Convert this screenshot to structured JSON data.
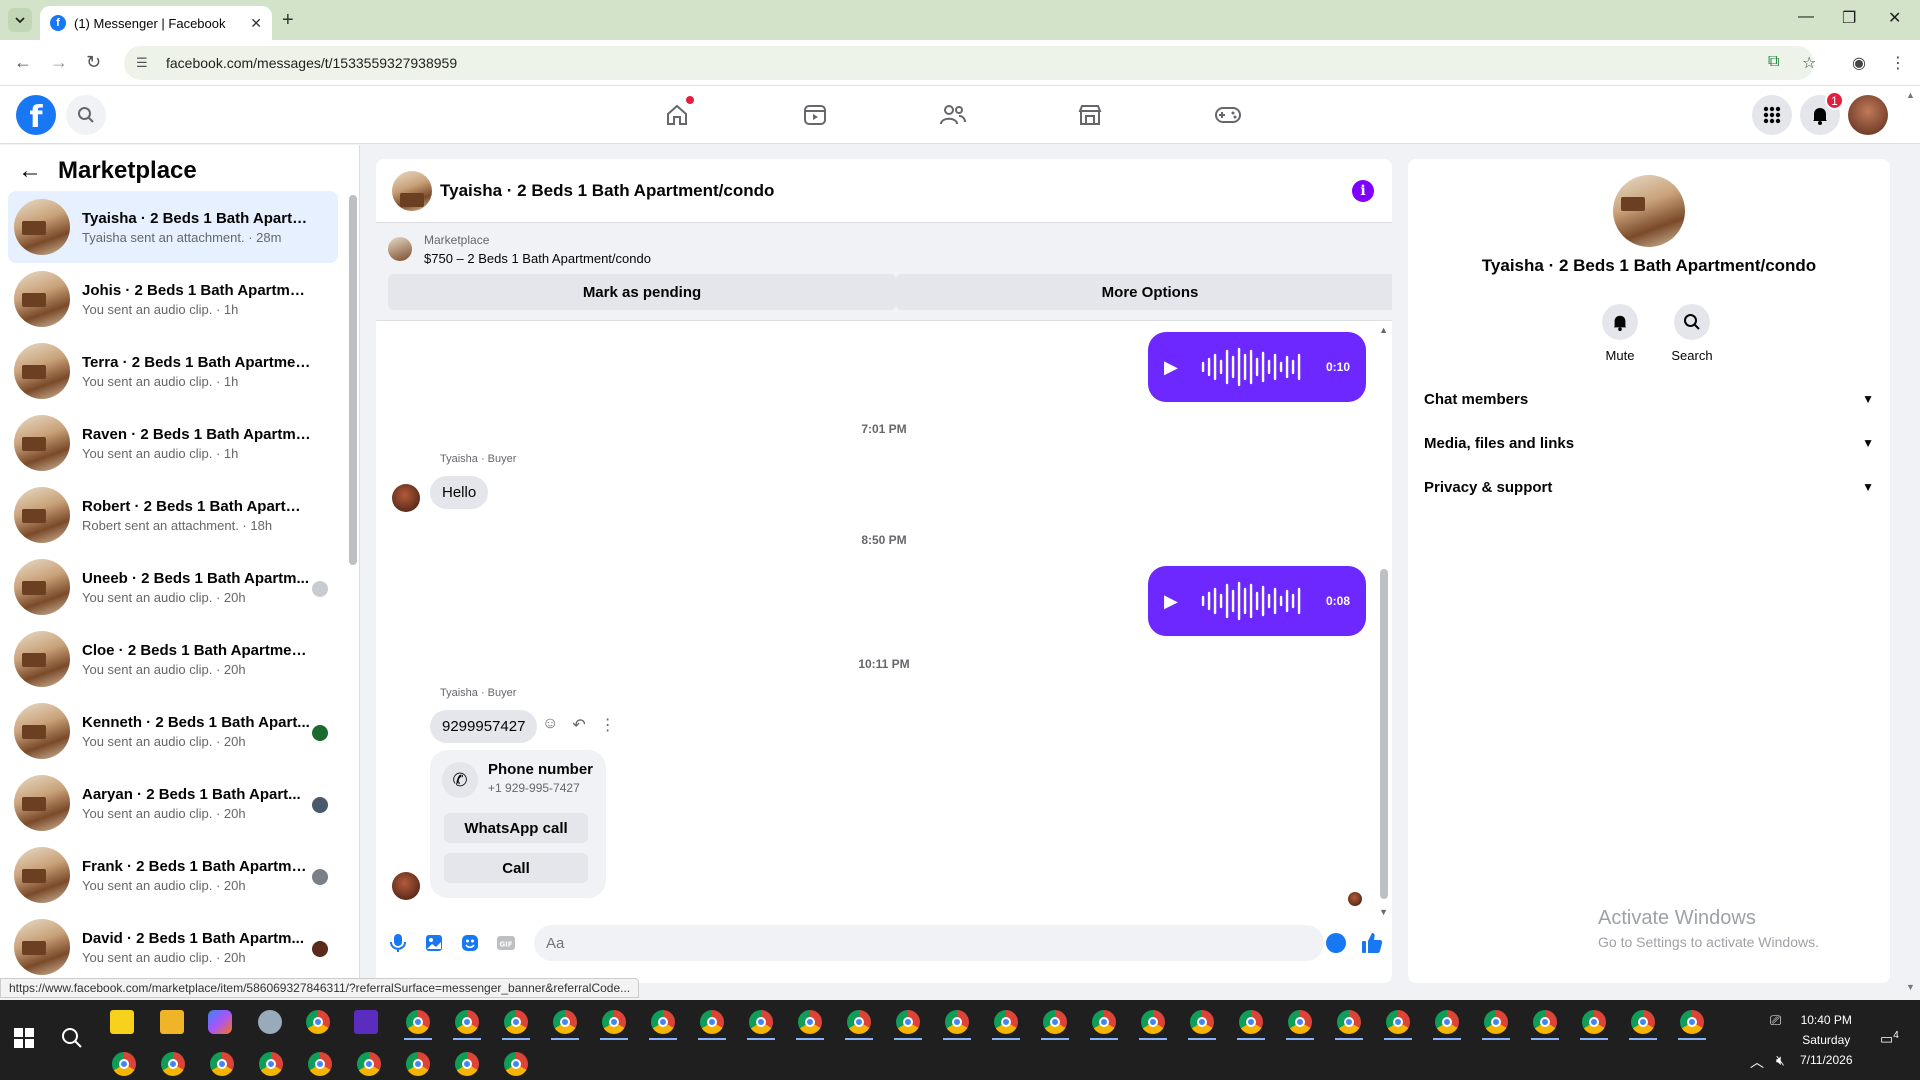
{
  "browser": {
    "tab_title": "(1) Messenger | Facebook",
    "url": "facebook.com/messages/t/1533559327938959",
    "status_link": "https://www.facebook.com/marketplace/item/586069327846311/?referralSurface=messenger_banner&referralCode..."
  },
  "fbnav": {
    "notification_count": "1"
  },
  "sidebar": {
    "title": "Marketplace",
    "conversations": [
      {
        "name": "Tyaisha · 2 Beds 1 Bath Apartme...",
        "sub": "Tyaisha sent an attachment. · 28m"
      },
      {
        "name": "Johis · 2 Beds 1 Bath Apartment/...",
        "sub": "You sent an audio clip. · 1h"
      },
      {
        "name": "Terra · 2 Beds 1 Bath Apartment/...",
        "sub": "You sent an audio clip. · 1h"
      },
      {
        "name": "Raven · 2 Beds 1 Bath Apartmen...",
        "sub": "You sent an audio clip. · 1h"
      },
      {
        "name": "Robert · 2 Beds 1 Bath Apartmen...",
        "sub": "Robert sent an attachment. · 18h"
      },
      {
        "name": "Uneeb · 2 Beds 1 Bath Apartm...",
        "sub": "You sent an audio clip. · 20h"
      },
      {
        "name": "Cloe · 2 Beds 1 Bath Apartment/...",
        "sub": "You sent an audio clip. · 20h"
      },
      {
        "name": "Kenneth · 2 Beds 1 Bath Apart...",
        "sub": "You sent an audio clip. · 20h"
      },
      {
        "name": "Aaryan · 2 Beds 1 Bath Apart...",
        "sub": "You sent an audio clip. · 20h"
      },
      {
        "name": "Frank · 2 Beds 1 Bath Apartme...",
        "sub": "You sent an audio clip. · 20h"
      },
      {
        "name": "David · 2 Beds 1 Bath Apartm...",
        "sub": "You sent an audio clip. · 20h"
      }
    ]
  },
  "chat": {
    "title": "Tyaisha · 2 Beds 1 Bath Apartment/condo",
    "banner_label": "Marketplace",
    "banner_title": "$750 – 2 Beds 1 Bath Apartment/condo",
    "mark_pending": "Mark as pending",
    "more_options": "More Options",
    "audio1_duration": "0:10",
    "time1": "7:01 PM",
    "sender_label": "Tyaisha · Buyer",
    "msg_hello": "Hello",
    "time2": "8:50 PM",
    "audio2_duration": "0:08",
    "time3": "10:11 PM",
    "msg_phone": "9299957427",
    "phone_card_title": "Phone number",
    "phone_card_number": "+1 929-995-7427",
    "whatsapp_call": "WhatsApp call",
    "call": "Call",
    "composer_placeholder": "Aa"
  },
  "info": {
    "name": "Tyaisha · 2 Beds 1 Bath Apartment/condo",
    "mute": "Mute",
    "search": "Search",
    "sections": [
      "Chat members",
      "Media, files and links",
      "Privacy & support"
    ],
    "activate_title": "Activate Windows",
    "activate_sub": "Go to Settings to activate Windows."
  },
  "taskbar": {
    "time": "10:40 PM",
    "day": "Saturday",
    "date": "7/11/2026",
    "notif_count": "4"
  },
  "colors": {
    "brand": "#1877f2",
    "audio_bubble": "#6d28ff",
    "info_icon": "#7f00ff"
  }
}
